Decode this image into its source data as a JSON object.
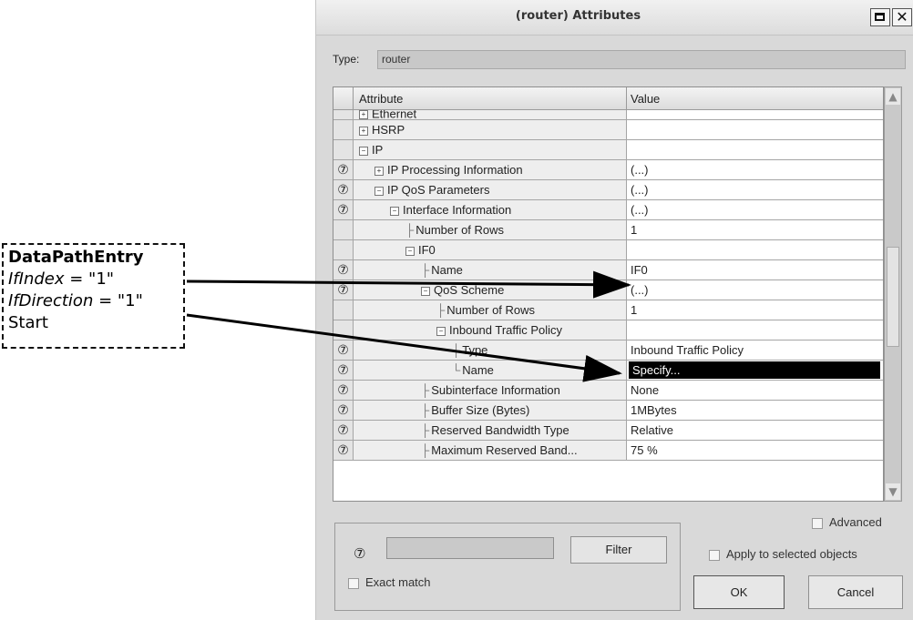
{
  "annotation": {
    "title": "DataPathEntry",
    "line1_var": "IfIndex",
    "line1_val": " = \"1\"",
    "line2_var": "IfDirection",
    "line2_val": " = \"1\"",
    "line3": "Start"
  },
  "dialog": {
    "title": "(router) Attributes",
    "type_label": "Type:",
    "type_value": "router",
    "col_attribute": "Attribute",
    "col_value": "Value",
    "rows": [
      {
        "help": false,
        "indent": 0,
        "expander": "+",
        "label": "Ethernet",
        "value": "",
        "partial": true
      },
      {
        "help": false,
        "indent": 0,
        "expander": "+",
        "label": "HSRP",
        "value": ""
      },
      {
        "help": false,
        "indent": 0,
        "expander": "−",
        "label": "IP",
        "value": ""
      },
      {
        "help": true,
        "indent": 1,
        "expander": "+",
        "label": "IP Processing Information",
        "value": "(...)"
      },
      {
        "help": true,
        "indent": 1,
        "expander": "−",
        "label": "IP QoS Parameters",
        "value": "(...)"
      },
      {
        "help": true,
        "indent": 2,
        "expander": "−",
        "label": "Interface Information",
        "value": "(...)"
      },
      {
        "help": false,
        "indent": 3,
        "tree": "├",
        "label": "Number of Rows",
        "value": "1"
      },
      {
        "help": false,
        "indent": 3,
        "expander": "−",
        "label": "IF0",
        "value": ""
      },
      {
        "help": true,
        "indent": 4,
        "tree": "├",
        "label": "Name",
        "value": "IF0"
      },
      {
        "help": true,
        "indent": 4,
        "expander": "−",
        "label": "QoS Scheme",
        "value": "(...)"
      },
      {
        "help": false,
        "indent": 5,
        "tree": "├",
        "label": "Number of Rows",
        "value": "1"
      },
      {
        "help": false,
        "indent": 5,
        "expander": "−",
        "label": "Inbound Traffic Policy",
        "value": ""
      },
      {
        "help": true,
        "indent": 6,
        "tree": "├",
        "label": "Type",
        "value": "Inbound Traffic Policy"
      },
      {
        "help": true,
        "indent": 6,
        "tree": "└",
        "label": "Name",
        "value": "Specify...",
        "selected": true
      },
      {
        "help": true,
        "indent": 4,
        "tree": "├",
        "label": "Subinterface Information",
        "value": "None"
      },
      {
        "help": true,
        "indent": 4,
        "tree": "├",
        "label": "Buffer Size (Bytes)",
        "value": "1MBytes"
      },
      {
        "help": true,
        "indent": 4,
        "tree": "├",
        "label": "Reserved Bandwidth Type",
        "value": "Relative"
      },
      {
        "help": true,
        "indent": 4,
        "tree": "├",
        "label": "Maximum Reserved Band...",
        "value": "75 %"
      }
    ],
    "filter_button": "Filter",
    "exact_match": "Exact match",
    "advanced": "Advanced",
    "apply_selected": "Apply to selected objects",
    "ok": "OK",
    "cancel": "Cancel"
  }
}
